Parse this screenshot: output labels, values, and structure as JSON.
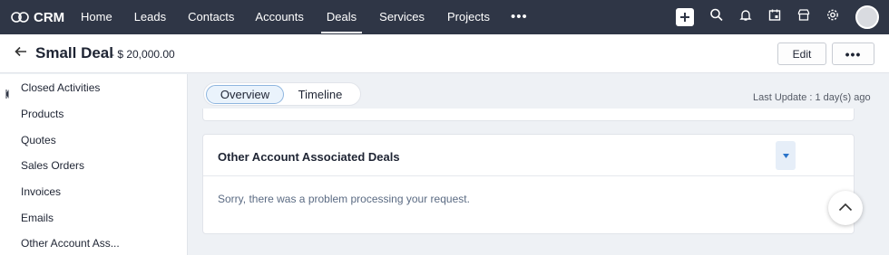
{
  "brand": {
    "name": "CRM"
  },
  "nav": {
    "items": [
      {
        "label": "Home",
        "active": false
      },
      {
        "label": "Leads",
        "active": false
      },
      {
        "label": "Contacts",
        "active": false
      },
      {
        "label": "Accounts",
        "active": false
      },
      {
        "label": "Deals",
        "active": true
      },
      {
        "label": "Services",
        "active": false
      },
      {
        "label": "Projects",
        "active": false
      }
    ],
    "more": "•••",
    "icons": [
      "plus-icon",
      "search-icon",
      "bell-icon",
      "calendar-icon",
      "store-icon",
      "gear-icon",
      "avatar"
    ]
  },
  "header": {
    "title": "Small Deal",
    "amount": "- $ 20,000.00",
    "edit_label": "Edit",
    "more_label": "•••"
  },
  "sidebar": {
    "items": [
      {
        "label": "Closed Activities"
      },
      {
        "label": "Products"
      },
      {
        "label": "Quotes"
      },
      {
        "label": "Sales Orders"
      },
      {
        "label": "Invoices"
      },
      {
        "label": "Emails"
      },
      {
        "label": "Other Account Ass..."
      }
    ]
  },
  "tabs": [
    {
      "label": "Overview",
      "active": true
    },
    {
      "label": "Timeline",
      "active": false
    }
  ],
  "last_update": "Last Update : 1 day(s) ago",
  "panel": {
    "title": "Other Account Associated Deals",
    "message": "Sorry, there was a problem processing your request."
  },
  "colors": {
    "topbar": "#2f3646",
    "accent": "#2a73c9"
  }
}
